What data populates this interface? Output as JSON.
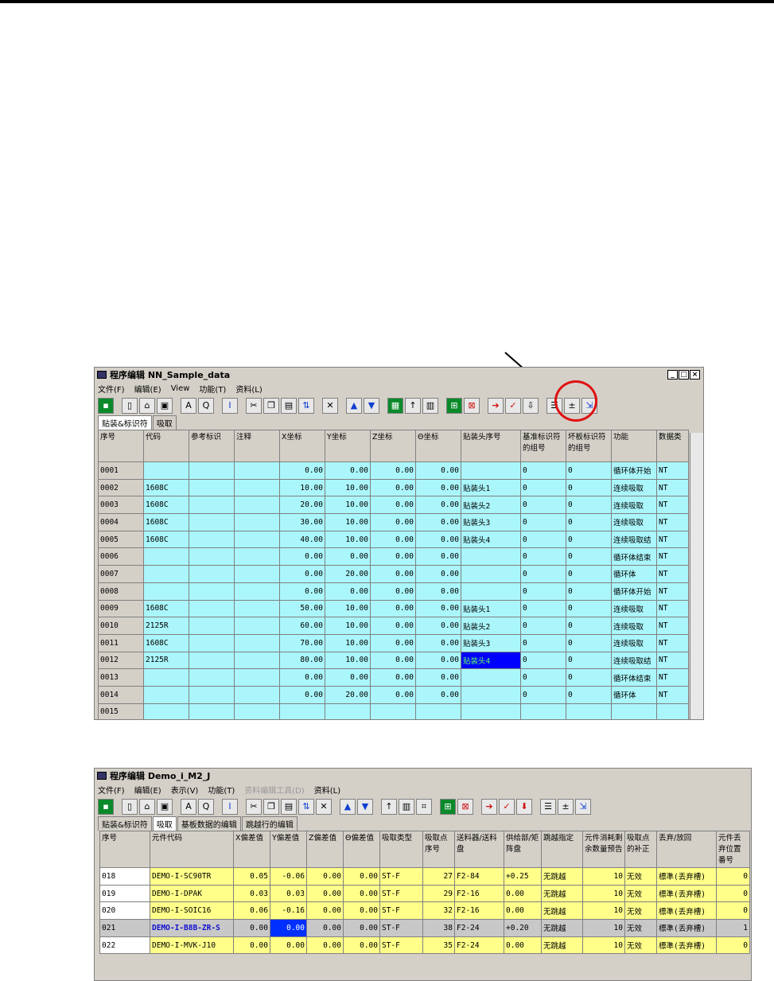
{
  "window1": {
    "title": "程序编辑 NN_Sample_data",
    "menu": [
      "文件(F)",
      "编辑(E)",
      "View",
      "功能(T)",
      "资料(L)"
    ],
    "tabs": [
      "贴装&标识符",
      "吸取"
    ],
    "columns": [
      "序号",
      "代码",
      "参考标识",
      "注释",
      "X坐标",
      "Y坐标",
      "Z坐标",
      "Θ坐标",
      "贴装头序号",
      "基准标识符的组号",
      "坏板标识符的组号",
      "功能",
      "数据类"
    ],
    "rows": [
      [
        "0001",
        "",
        "",
        "",
        "0.00",
        "0.00",
        "0.00",
        "0.00",
        "",
        "0",
        "0",
        "循环体开始",
        "NT"
      ],
      [
        "0002",
        "1608C",
        "",
        "",
        "10.00",
        "10.00",
        "0.00",
        "0.00",
        "贴装头1",
        "0",
        "0",
        "连续吸取",
        "NT"
      ],
      [
        "0003",
        "1608C",
        "",
        "",
        "20.00",
        "10.00",
        "0.00",
        "0.00",
        "贴装头2",
        "0",
        "0",
        "连续吸取",
        "NT"
      ],
      [
        "0004",
        "1608C",
        "",
        "",
        "30.00",
        "10.00",
        "0.00",
        "0.00",
        "贴装头3",
        "0",
        "0",
        "连续吸取",
        "NT"
      ],
      [
        "0005",
        "1608C",
        "",
        "",
        "40.00",
        "10.00",
        "0.00",
        "0.00",
        "贴装头4",
        "0",
        "0",
        "连续吸取结",
        "NT"
      ],
      [
        "0006",
        "",
        "",
        "",
        "0.00",
        "0.00",
        "0.00",
        "0.00",
        "",
        "0",
        "0",
        "循环体结束",
        "NT"
      ],
      [
        "0007",
        "",
        "",
        "",
        "0.00",
        "20.00",
        "0.00",
        "0.00",
        "",
        "0",
        "0",
        "循环体",
        "NT"
      ],
      [
        "0008",
        "",
        "",
        "",
        "0.00",
        "0.00",
        "0.00",
        "0.00",
        "",
        "0",
        "0",
        "循环体开始",
        "NT"
      ],
      [
        "0009",
        "1608C",
        "",
        "",
        "50.00",
        "10.00",
        "0.00",
        "0.00",
        "贴装头1",
        "0",
        "0",
        "连续吸取",
        "NT"
      ],
      [
        "0010",
        "2125R",
        "",
        "",
        "60.00",
        "10.00",
        "0.00",
        "0.00",
        "贴装头2",
        "0",
        "0",
        "连续吸取",
        "NT"
      ],
      [
        "0011",
        "1608C",
        "",
        "",
        "70.00",
        "10.00",
        "0.00",
        "0.00",
        "贴装头3",
        "0",
        "0",
        "连续吸取",
        "NT"
      ],
      [
        "0012",
        "2125R",
        "",
        "",
        "80.00",
        "10.00",
        "0.00",
        "0.00",
        "贴装头4",
        "0",
        "0",
        "连续吸取结",
        "NT"
      ],
      [
        "0013",
        "",
        "",
        "",
        "0.00",
        "0.00",
        "0.00",
        "0.00",
        "",
        "0",
        "0",
        "循环体结束",
        "NT"
      ],
      [
        "0014",
        "",
        "",
        "",
        "0.00",
        "20.00",
        "0.00",
        "0.00",
        "",
        "0",
        "0",
        "循环体",
        "NT"
      ],
      [
        "0015",
        "",
        "",
        "",
        "",
        "",
        "",
        "",
        "",
        "",
        "",
        "",
        ""
      ]
    ]
  },
  "window2": {
    "title": "程序编辑 Demo_i_M2_J",
    "menu": [
      "文件(F)",
      "编辑(E)",
      "表示(V)",
      "功能(T)",
      "资料编辑工具(D)",
      "资料(L)"
    ],
    "tabs": [
      "贴装&标识符",
      "吸取",
      "基板数据的编辑",
      "跳越行的编辑"
    ],
    "columns": [
      "序号",
      "元件代码",
      "X偏差值",
      "Y偏差值",
      "Z偏差值",
      "Θ偏差值",
      "吸取类型",
      "吸取点序号",
      "送料器/送料盘",
      "供给部/矩阵盘",
      "跳越指定",
      "元件消耗剩余数量预告",
      "吸取点的补正",
      "丢弃/放回",
      "元件丢弃位置番号"
    ],
    "rows": [
      [
        "018",
        "DEMO-I-SC90TR",
        "0.05",
        "-0.06",
        "0.00",
        "0.00",
        "ST-F",
        "27",
        "F2-84",
        "+0.25",
        "无跳越",
        "10",
        "无效",
        "標準(丢弃槽)",
        "0"
      ],
      [
        "019",
        "DEMO-I-DPAK",
        "0.03",
        "0.03",
        "0.00",
        "0.00",
        "ST-F",
        "29",
        "F2-16",
        "0.00",
        "无跳越",
        "10",
        "无效",
        "標準(丢弃槽)",
        "0"
      ],
      [
        "020",
        "DEMO-I-SOIC16",
        "0.06",
        "-0.16",
        "0.00",
        "0.00",
        "ST-F",
        "32",
        "F2-16",
        "0.00",
        "无跳越",
        "10",
        "无效",
        "標準(丢弃槽)",
        "0"
      ],
      [
        "021",
        "DEMO-I-B8B-ZR-S",
        "0.00",
        "0.00",
        "0.00",
        "0.00",
        "ST-F",
        "38",
        "F2-24",
        "+0.20",
        "无跳越",
        "10",
        "无效",
        "標準(丢弃槽)",
        "1"
      ],
      [
        "022",
        "DEMO-I-MVK-J10",
        "0.00",
        "0.00",
        "0.00",
        "0.00",
        "ST-F",
        "35",
        "F2-24",
        "0.00",
        "无跳越",
        "10",
        "无效",
        "標準(丢弃槽)",
        "0"
      ]
    ]
  }
}
